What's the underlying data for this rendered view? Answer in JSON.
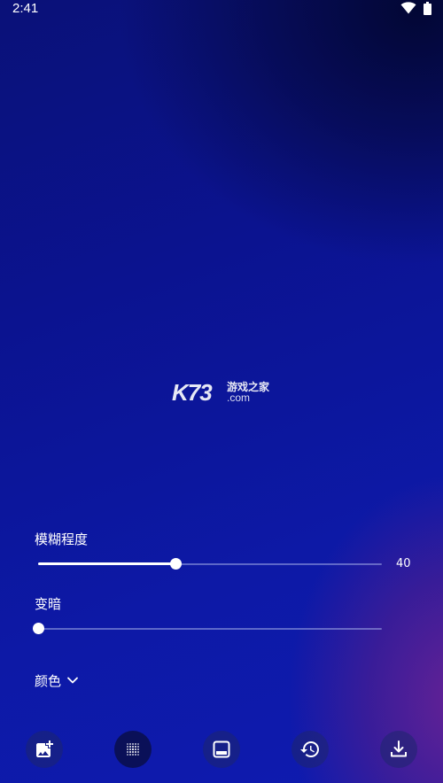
{
  "status_bar": {
    "time": "2:41"
  },
  "watermark": {
    "logo_text": "K73",
    "chinese_text": "游戏之家",
    "domain_text": ".com"
  },
  "controls": {
    "blur": {
      "label": "模糊程度",
      "value": 40,
      "value_text": "40",
      "min": 0,
      "max": 100
    },
    "darken": {
      "label": "变暗",
      "value": 0,
      "min": 0,
      "max": 100
    },
    "color": {
      "label": "颜色"
    }
  },
  "toolbar": {
    "buttons": [
      {
        "icon": "add-image-icon"
      },
      {
        "icon": "texture-grid-icon",
        "active": true
      },
      {
        "icon": "layout-bottom-bar-icon"
      },
      {
        "icon": "history-icon"
      },
      {
        "icon": "download-icon"
      }
    ]
  },
  "colors": {
    "background_top": "#0a1178",
    "background_bottom": "#0e1bb0",
    "accent_purple": "#6a2294",
    "slider_track": "#a0aae6",
    "foreground": "#ffffff"
  }
}
